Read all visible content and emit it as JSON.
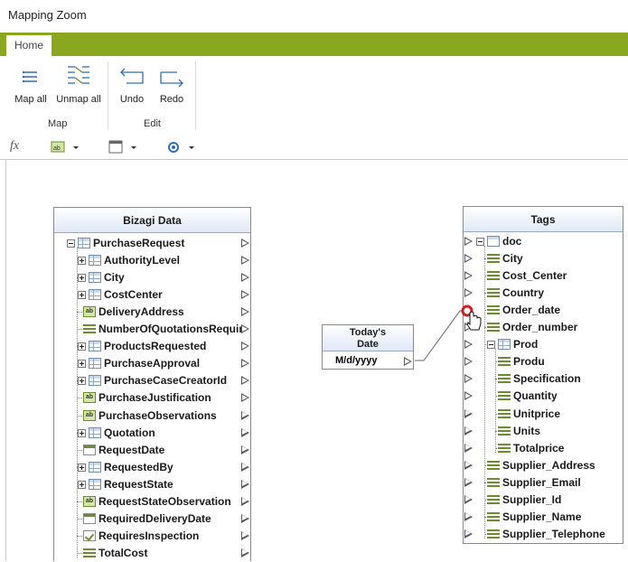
{
  "window": {
    "title": "Mapping Zoom"
  },
  "ribbon": {
    "tab_home": "Home",
    "buttons": {
      "map_all": "Map all",
      "unmap_all": "Unmap all",
      "undo": "Undo",
      "redo": "Redo"
    },
    "groups": {
      "map": "Map",
      "edit": "Edit"
    }
  },
  "toolbar": {
    "fx": "fx"
  },
  "source_panel": {
    "title": "Bizagi Data",
    "items": [
      {
        "label": "PurchaseRequest",
        "icon": "table-icon",
        "expander": "minus"
      },
      {
        "label": "AuthorityLevel",
        "icon": "table-icon",
        "expander": "plus"
      },
      {
        "label": "City",
        "icon": "table-icon",
        "expander": "plus"
      },
      {
        "label": "CostCenter",
        "icon": "table-icon",
        "expander": "plus"
      },
      {
        "label": "DeliveryAddress",
        "icon": "text-field-icon",
        "expander": ""
      },
      {
        "label": "NumberOfQuotationsRequir",
        "icon": "list-icon",
        "expander": ""
      },
      {
        "label": "ProductsRequested",
        "icon": "collection-icon",
        "expander": "plus"
      },
      {
        "label": "PurchaseApproval",
        "icon": "collection-icon",
        "expander": "plus"
      },
      {
        "label": "PurchaseCaseCreatorId",
        "icon": "user-icon",
        "expander": "plus"
      },
      {
        "label": "PurchaseJustification",
        "icon": "text-field-icon",
        "expander": ""
      },
      {
        "label": "PurchaseObservations",
        "icon": "text-field-icon",
        "expander": ""
      },
      {
        "label": "Quotation",
        "icon": "collection-icon",
        "expander": "plus"
      },
      {
        "label": "RequestDate",
        "icon": "date-icon",
        "expander": ""
      },
      {
        "label": "RequestedBy",
        "icon": "user-icon",
        "expander": "plus"
      },
      {
        "label": "RequestState",
        "icon": "table-icon",
        "expander": "plus"
      },
      {
        "label": "RequestStateObservation",
        "icon": "text-field-icon",
        "expander": ""
      },
      {
        "label": "RequiredDeliveryDate",
        "icon": "date-icon",
        "expander": ""
      },
      {
        "label": "RequiresInspection",
        "icon": "checkbox-icon",
        "expander": ""
      },
      {
        "label": "TotalCost",
        "icon": "list-icon",
        "expander": ""
      }
    ]
  },
  "function_box": {
    "title": "Today's Date",
    "title_line1": "Today's",
    "title_line2": "Date",
    "output": "M/d/yyyy"
  },
  "target_panel": {
    "title": "Tags",
    "items": [
      {
        "label": "doc",
        "icon": "doc-icon",
        "expander": "minus"
      },
      {
        "label": "City",
        "icon": "list-icon"
      },
      {
        "label": "Cost_Center",
        "icon": "list-icon"
      },
      {
        "label": "Country",
        "icon": "list-icon"
      },
      {
        "label": "Order_date",
        "icon": "list-icon"
      },
      {
        "label": "Order_number",
        "icon": "list-icon"
      },
      {
        "label": "Prod",
        "icon": "collection-icon",
        "expander": "minus"
      },
      {
        "label": "Produ",
        "icon": "list-icon"
      },
      {
        "label": "Specification",
        "icon": "list-icon"
      },
      {
        "label": "Quantity",
        "icon": "list-icon"
      },
      {
        "label": "Unitprice",
        "icon": "list-icon"
      },
      {
        "label": "Units",
        "icon": "list-icon"
      },
      {
        "label": "Totalprice",
        "icon": "list-icon"
      },
      {
        "label": "Supplier_Address",
        "icon": "list-icon"
      },
      {
        "label": "Supplier_Email",
        "icon": "list-icon"
      },
      {
        "label": "Supplier_Id",
        "icon": "list-icon"
      },
      {
        "label": "Supplier_Name",
        "icon": "list-icon"
      },
      {
        "label": "Supplier_Telephone",
        "icon": "list-icon"
      }
    ]
  },
  "colors": {
    "ribbon_green": "#8ba71f",
    "icon_blue": "#2f6fb3",
    "connection_point": "#cc1f1f"
  }
}
